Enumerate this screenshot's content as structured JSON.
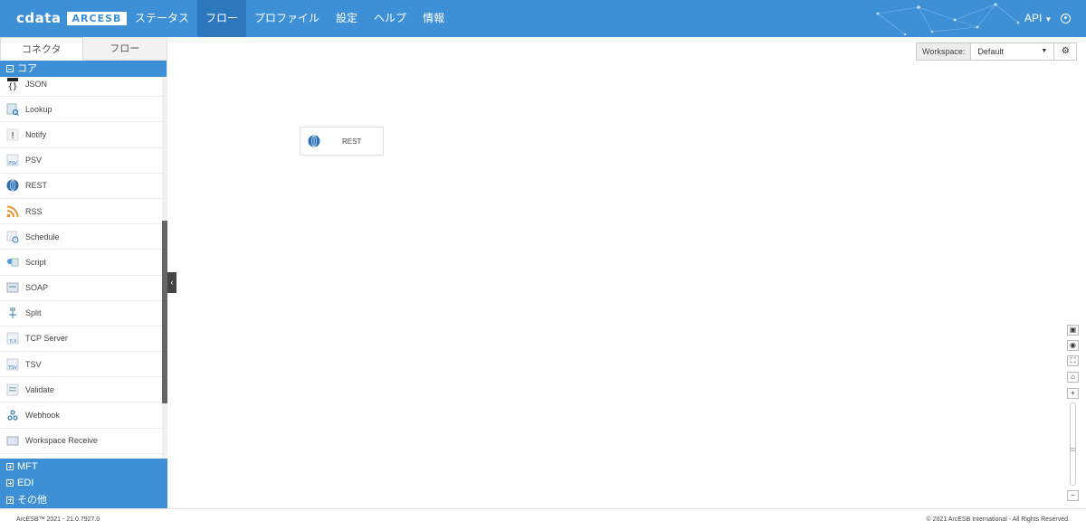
{
  "brand": {
    "logo_text": "cdata",
    "product": "ARCESB"
  },
  "nav": {
    "items": [
      {
        "label": "ステータス"
      },
      {
        "label": "フロー",
        "active": true
      },
      {
        "label": "プロファイル"
      },
      {
        "label": "設定"
      },
      {
        "label": "ヘルプ"
      },
      {
        "label": "情報"
      }
    ],
    "api_label": "API"
  },
  "sidebar": {
    "tabs": [
      {
        "label": "コネクタ",
        "active": true
      },
      {
        "label": "フロー",
        "active": false
      }
    ],
    "core_group": "コア",
    "connectors": [
      {
        "label": "JSON",
        "icon": "json-icon"
      },
      {
        "label": "Lookup",
        "icon": "lookup-icon"
      },
      {
        "label": "Notify",
        "icon": "notify-icon"
      },
      {
        "label": "PSV",
        "icon": "psv-icon"
      },
      {
        "label": "REST",
        "icon": "globe-icon"
      },
      {
        "label": "RSS",
        "icon": "rss-icon"
      },
      {
        "label": "Schedule",
        "icon": "schedule-icon"
      },
      {
        "label": "Script",
        "icon": "script-icon"
      },
      {
        "label": "SOAP",
        "icon": "soap-icon"
      },
      {
        "label": "Split",
        "icon": "split-icon"
      },
      {
        "label": "TCP Server",
        "icon": "tcp-icon"
      },
      {
        "label": "TSV",
        "icon": "tsv-icon"
      },
      {
        "label": "Validate",
        "icon": "validate-icon"
      },
      {
        "label": "Webhook",
        "icon": "webhook-icon"
      },
      {
        "label": "Workspace Receive",
        "icon": "workspace-receive-icon"
      }
    ],
    "other_groups": [
      "MFT",
      "EDI",
      "その他"
    ]
  },
  "canvas": {
    "workspace_label": "Workspace:",
    "workspace_value": "Default",
    "node_label": "REST"
  },
  "footer": {
    "version": "ArcESB™ 2021 - 21.0.7927.0",
    "copyright": "© 2021 ArcESB International - All Rights Reserved."
  },
  "colors": {
    "accent": "#3d8fd6",
    "accent_dark": "#2d78bd"
  }
}
